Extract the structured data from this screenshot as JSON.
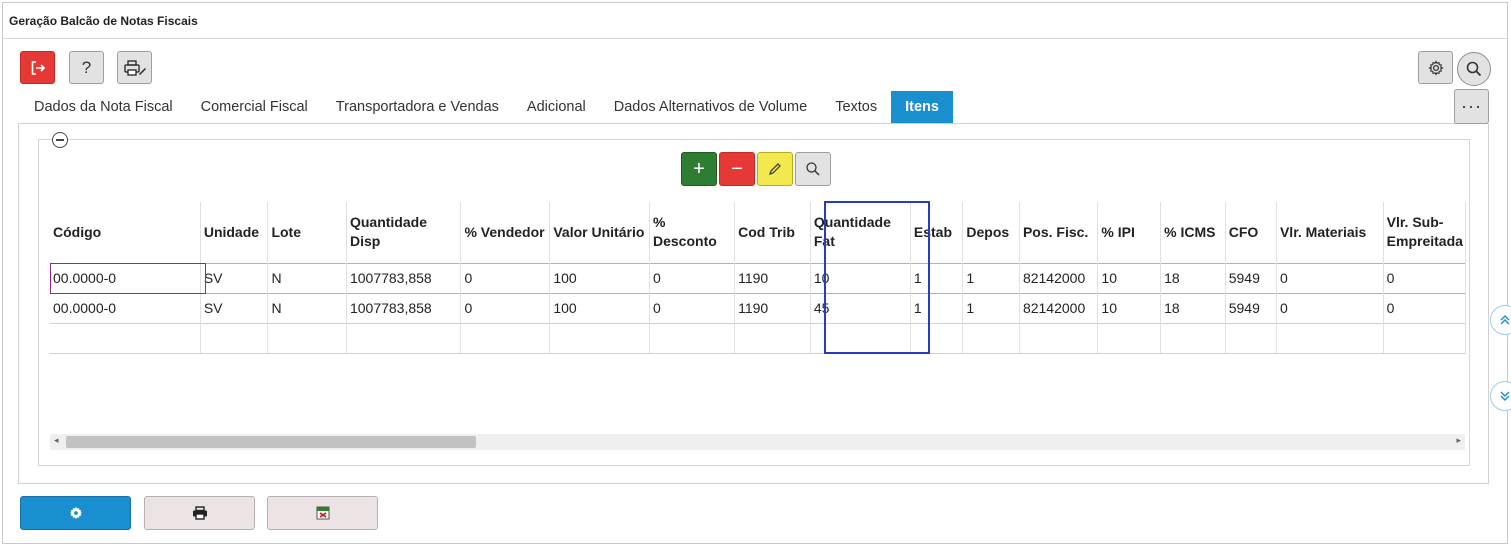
{
  "window": {
    "title": "Geração Balcão de Notas Fiscais"
  },
  "toolbar": {
    "exit_icon": "exit-icon",
    "help_label": "?",
    "print_icon": "printer-edit-icon",
    "settings_icon": "gear-icon",
    "search_icon": "search-icon"
  },
  "tabs": [
    {
      "label": "Dados da Nota Fiscal",
      "active": false
    },
    {
      "label": "Comercial Fiscal",
      "active": false
    },
    {
      "label": "Transportadora e Vendas",
      "active": false
    },
    {
      "label": "Adicional",
      "active": false
    },
    {
      "label": "Dados Alternativos de Volume",
      "active": false
    },
    {
      "label": "Textos",
      "active": false
    },
    {
      "label": "Itens",
      "active": true
    }
  ],
  "more_label": "···",
  "grid_actions": {
    "add_label": "+",
    "remove_label": "−",
    "edit_icon": "pencil-icon",
    "search_icon": "search-icon"
  },
  "table": {
    "columns": [
      {
        "key": "codigo",
        "label": "Código"
      },
      {
        "key": "unidade",
        "label": "Unidade"
      },
      {
        "key": "lote",
        "label": "Lote"
      },
      {
        "key": "qtd_disp",
        "label": "Quantidade Disp"
      },
      {
        "key": "vendedor",
        "label": "% Vendedor"
      },
      {
        "key": "valor_unit",
        "label": "Valor Unitário"
      },
      {
        "key": "desconto",
        "label": "% Desconto"
      },
      {
        "key": "cod_trib",
        "label": "Cod Trib"
      },
      {
        "key": "qtd_fat",
        "label": "Quantidade Fat"
      },
      {
        "key": "estab",
        "label": "Estab"
      },
      {
        "key": "depos",
        "label": "Depos"
      },
      {
        "key": "pos_fisc",
        "label": "Pos. Fisc."
      },
      {
        "key": "ipi",
        "label": "% IPI"
      },
      {
        "key": "icms",
        "label": "% ICMS"
      },
      {
        "key": "cfo",
        "label": "CFO"
      },
      {
        "key": "vlr_materiais",
        "label": "Vlr. Materiais"
      },
      {
        "key": "vlr_sub",
        "label": "Vlr. Sub-Empreitada"
      }
    ],
    "rows": [
      [
        "00.0000-0",
        "SV",
        "N",
        "1007783,858",
        "0",
        "100",
        "0",
        "1190",
        "10",
        "1",
        "1",
        "82142000",
        "10",
        "18",
        "5949",
        "0",
        "0"
      ],
      [
        "00.0000-0",
        "SV",
        "N",
        "1007783,858",
        "0",
        "100",
        "0",
        "1190",
        "45",
        "1",
        "1",
        "82142000",
        "10",
        "18",
        "5949",
        "0",
        "0"
      ]
    ]
  },
  "footer": {
    "settings_icon": "gear-icon",
    "print_icon": "printer-icon",
    "export_icon": "document-export-icon"
  },
  "side_nav": {
    "up_icon": "double-chevron-up-icon",
    "down_icon": "double-chevron-down-icon"
  }
}
